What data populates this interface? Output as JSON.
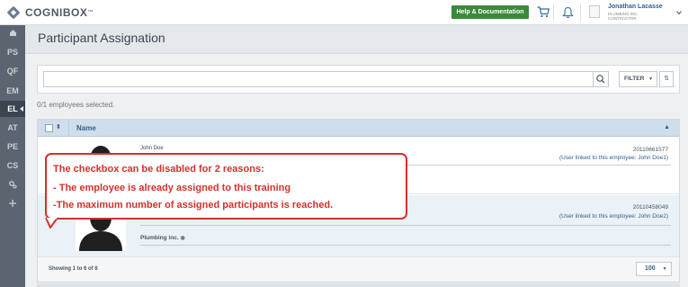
{
  "app": {
    "logo_text": "COGNIBOX",
    "logo_tm": "™"
  },
  "header": {
    "help_label": "Help & Documentation",
    "user_name": "Jonathan Lacasse",
    "user_company": "PLUMBING INC.",
    "user_role": "CONTRACTOR",
    "icons": [
      "cart-icon",
      "bell-icon",
      "chevron-down-icon"
    ]
  },
  "nav": {
    "items": [
      {
        "label": "",
        "icon": "home-icon"
      },
      {
        "label": "PS"
      },
      {
        "label": "QF"
      },
      {
        "label": "EM"
      },
      {
        "label": "EL"
      },
      {
        "label": "AT"
      },
      {
        "label": "PE"
      },
      {
        "label": "CS"
      },
      {
        "label": "",
        "icon": "gears-icon"
      },
      {
        "label": "",
        "icon": "pin-icon"
      }
    ],
    "active": "EL"
  },
  "page": {
    "title": "Participant Assignation"
  },
  "search": {
    "placeholder": "",
    "filter_label": "FILTER",
    "sort_label": "⇅"
  },
  "selection": {
    "text": "0/1 employees selected."
  },
  "table": {
    "name_header": "Name",
    "rows": [
      {
        "name": "John Doe",
        "company": "",
        "id": "20110661577",
        "link": "(User linked to this employee: John Doe1)"
      },
      {
        "name": "",
        "company": "Plumbing inc.",
        "id": "20110458049",
        "link": "(User linked to this employee: John Doe2)"
      }
    ],
    "showing": "Showing 1 to 6 of 6",
    "page_size": "100"
  },
  "callout": {
    "line1": "The checkbox can be disabled for 2 reasons:",
    "line2": "- The employee is already assigned to this training",
    "line3": "-The maximum number of assigned participants is reached.",
    "color": "#d3312b"
  }
}
